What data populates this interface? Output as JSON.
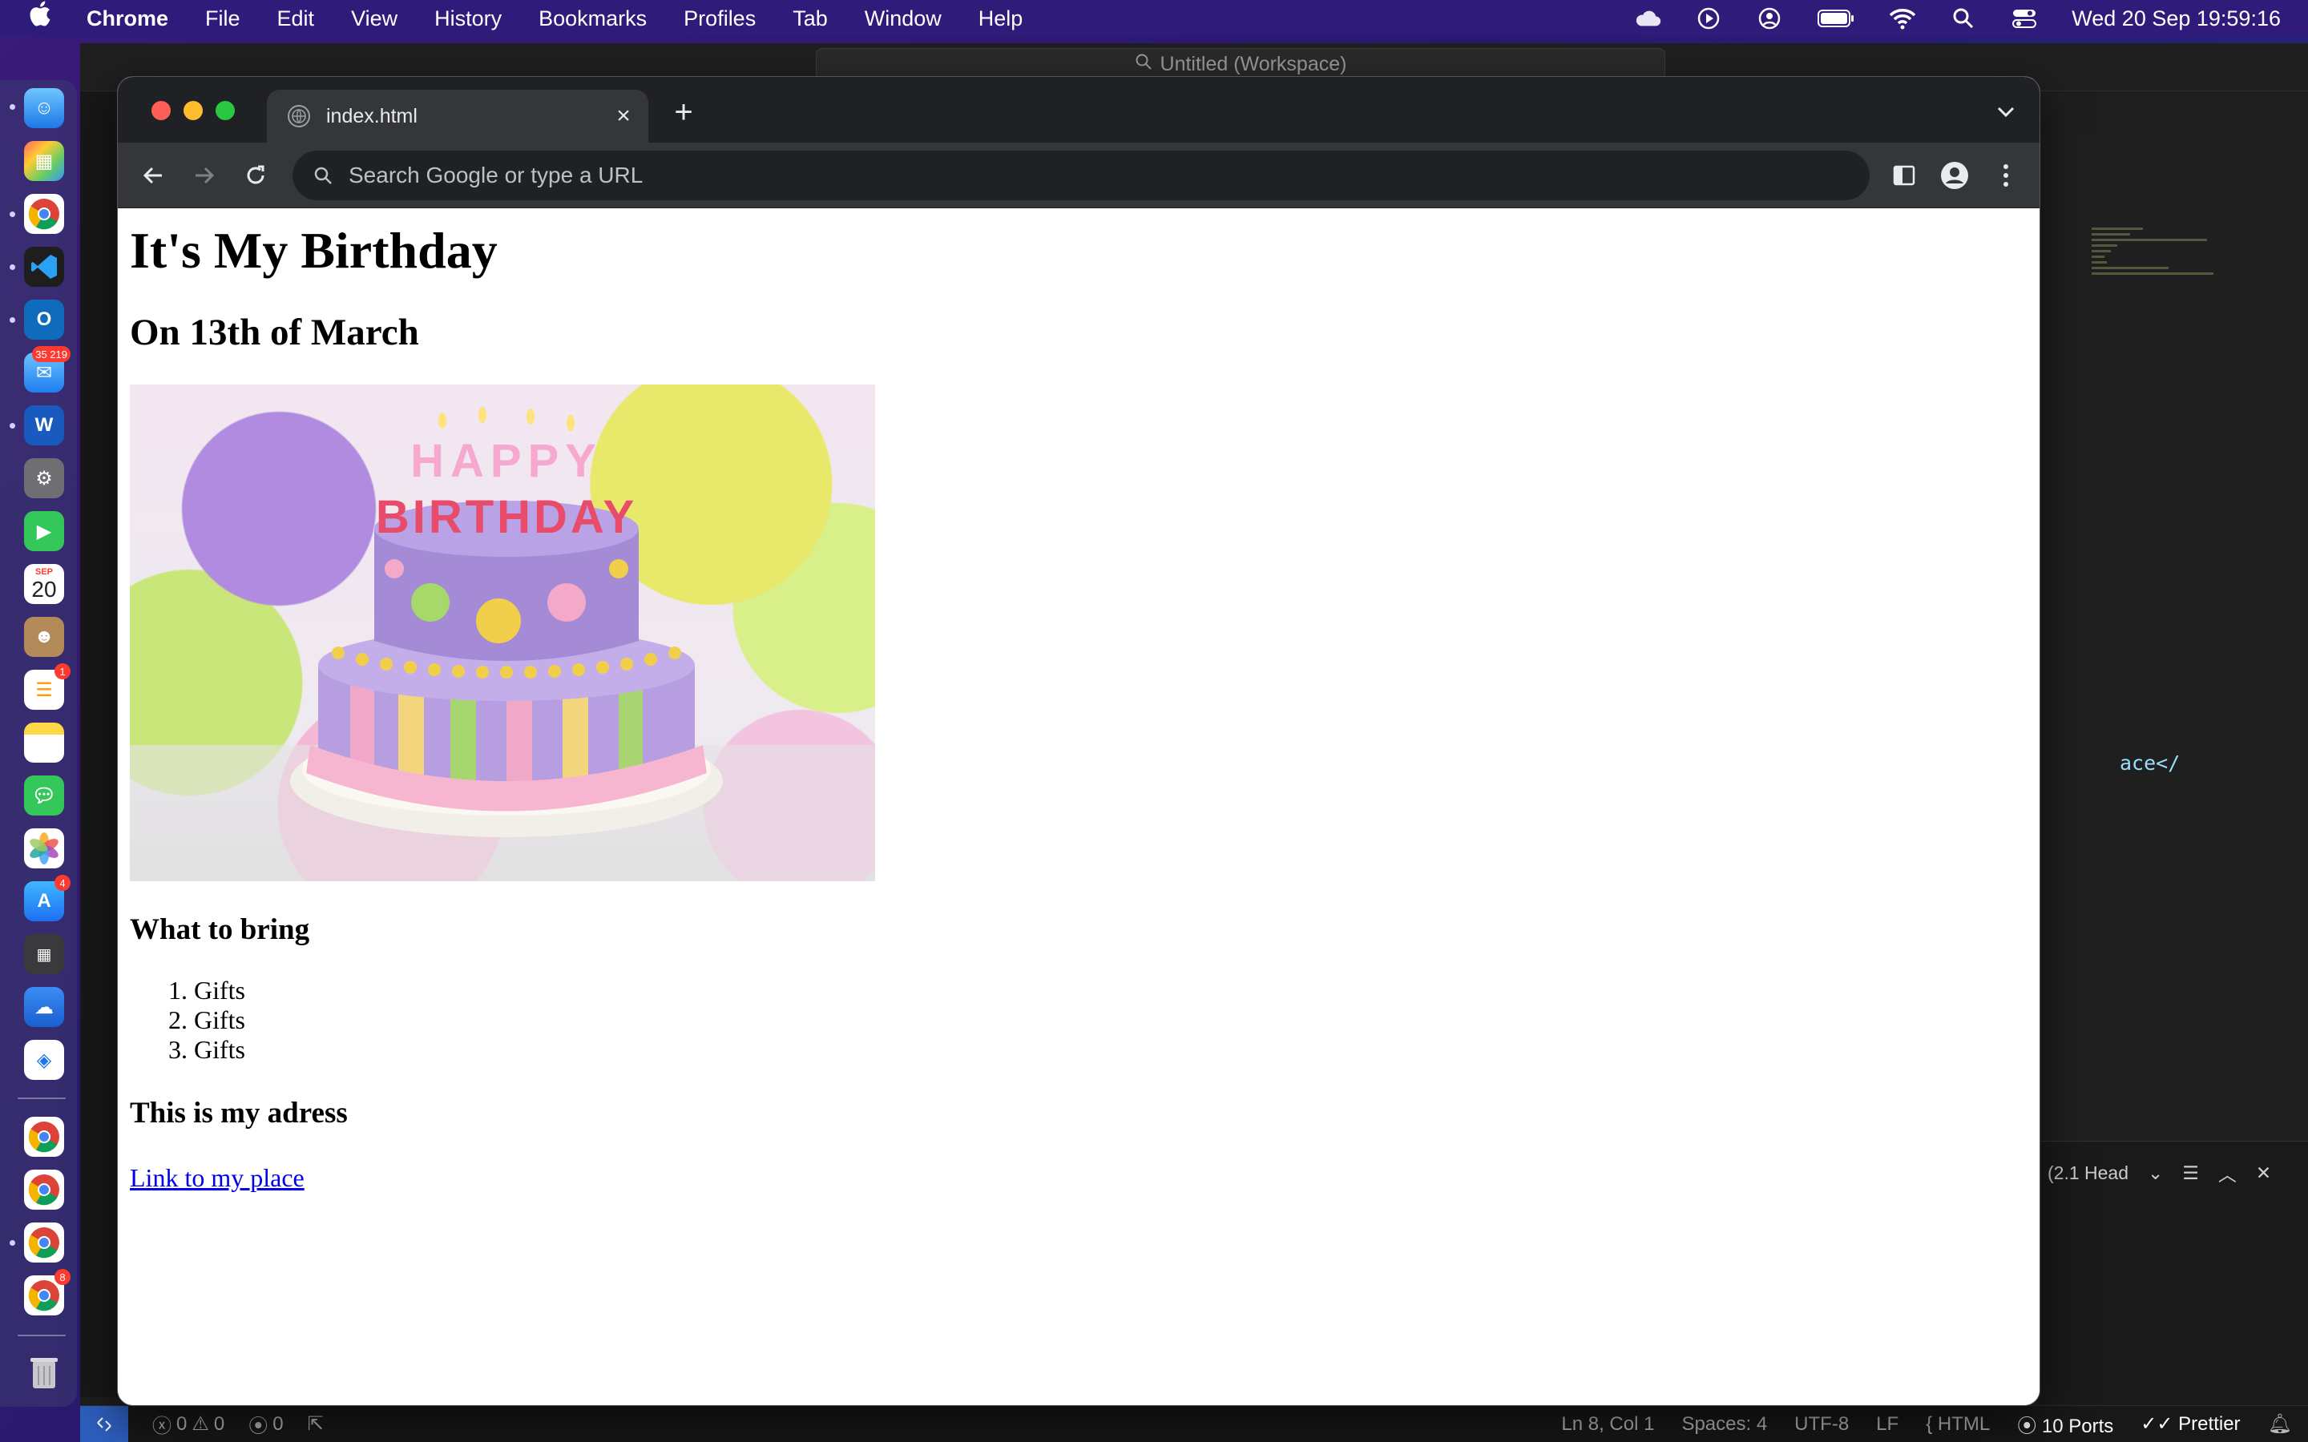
{
  "menubar": {
    "app": "Chrome",
    "items": [
      "File",
      "Edit",
      "View",
      "History",
      "Bookmarks",
      "Profiles",
      "Tab",
      "Window",
      "Help"
    ],
    "clock": "Wed 20 Sep  19:59:16",
    "status_icons": [
      "icloud-icon",
      "play-icon",
      "user-icon",
      "battery-icon",
      "wifi-icon",
      "spotlight-icon",
      "control-center-icon"
    ]
  },
  "dock": {
    "calendar_month": "SEP",
    "calendar_day": "20",
    "mail_badge": "35 219",
    "reminders_badge": "1",
    "appstore_badge": "4",
    "chrome_badge": "8"
  },
  "vscode": {
    "search": "Untitled (Workspace)",
    "code_fragment": "ace</",
    "panel_dropdown": "(2.1 Head",
    "status": {
      "problems_errors": "0",
      "problems_warnings": "0",
      "ports_left": "0",
      "position": "Ln 8, Col 1",
      "spaces": "Spaces: 4",
      "encoding": "UTF-8",
      "eol": "LF",
      "language": "HTML",
      "ports": "10 Ports",
      "formatter": "Prettier"
    }
  },
  "chrome": {
    "tab_title": "index.html",
    "omnibox_placeholder": "Search Google or type a URL"
  },
  "page": {
    "h1": "It's My Birthday",
    "h2": "On 13th of March",
    "bring_heading": "What to bring",
    "bring_items": [
      "Gifts",
      "Gifts",
      "Gifts"
    ],
    "address_heading": "This is my adress",
    "link_text": "Link to my place",
    "cake_lettering": [
      "HAPPY",
      "BIRTHDAY"
    ]
  },
  "colors": {
    "menubar": "#2e1b7a",
    "chrome_frame": "#202124",
    "chrome_toolbar": "#35363a",
    "link": "#0000ee",
    "vscode_remote": "#2d5fbf"
  }
}
